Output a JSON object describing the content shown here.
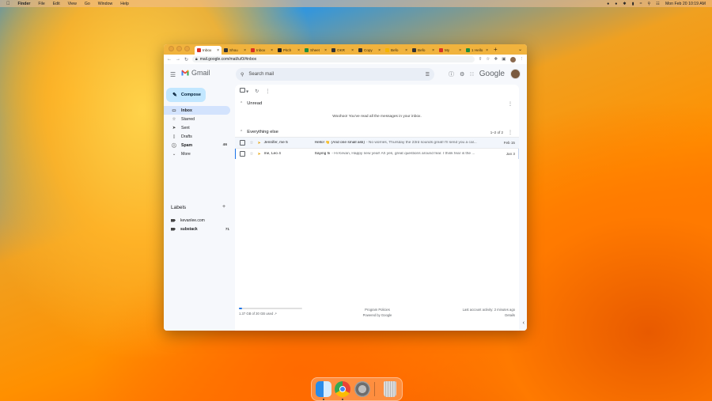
{
  "menubar": {
    "apple": "",
    "app": "Finder",
    "menus": [
      "File",
      "Edit",
      "View",
      "Go",
      "Window",
      "Help"
    ],
    "clock": "Mon Feb 20  10:19 AM"
  },
  "browser": {
    "tabs": [
      {
        "title": "Inbox",
        "active": true,
        "favicon_color": "#d93025"
      },
      {
        "title": "Shou",
        "favicon_color": "#333333"
      },
      {
        "title": "Inbox",
        "favicon_color": "#d93025"
      },
      {
        "title": "Pitch",
        "favicon_color": "#222222"
      },
      {
        "title": "Sheet",
        "favicon_color": "#1e8e3e"
      },
      {
        "title": "OKR",
        "favicon_color": "#333333"
      },
      {
        "title": "Copy",
        "favicon_color": "#333333"
      },
      {
        "title": "Befo",
        "favicon_color": "#f4b400"
      },
      {
        "title": "Befo",
        "favicon_color": "#333333"
      },
      {
        "title": "My",
        "favicon_color": "#d93025"
      },
      {
        "title": "1 Hello",
        "favicon_color": "#1e8e3e"
      }
    ],
    "url": "mail.google.com/mail/u/0/#inbox"
  },
  "gmail": {
    "logo": "Gmail",
    "search_placeholder": "Search mail",
    "google": "Google",
    "compose": "Compose",
    "nav": [
      {
        "label": "Inbox",
        "icon": "inbox-icon",
        "active": true,
        "count": ""
      },
      {
        "label": "Starred",
        "icon": "star-icon",
        "count": ""
      },
      {
        "label": "Sent",
        "icon": "send-icon",
        "count": ""
      },
      {
        "label": "Drafts",
        "icon": "draft-icon",
        "count": ""
      },
      {
        "label": "Spam",
        "icon": "spam-icon",
        "count": "46",
        "bold": true
      },
      {
        "label": "More",
        "icon": "chevron-down-icon",
        "count": ""
      }
    ],
    "labels_heading": "Labels",
    "labels": [
      {
        "name": "kevanlee.com",
        "count": ""
      },
      {
        "name": "substack",
        "count": "71"
      }
    ],
    "sections": {
      "unread": "Unread",
      "unread_empty": "Woohoo! You've read all the messages in your inbox.",
      "everything": "Everything else",
      "range": "1–2 of 2"
    },
    "emails": [
      {
        "from": "Jennifer, me 5",
        "subject": "Hello! 👋 (And one small ask)",
        "snippet": " - No worries, Thursday the 23rd sounds great! I'll send you a cal...",
        "date": "Feb 15"
      },
      {
        "from": "me, Leo 4",
        "subject": "Saying hi",
        "snippet": " - Hi Kevan, Happy new year! Ah yes, great questions around fear. I think fear is the ...",
        "date": "Jan 3"
      }
    ],
    "footer": {
      "storage": "1.37 GB of 30 GB used",
      "storage_fraction": 0.046,
      "policies": "Program Policies",
      "powered": "Powered by Google",
      "activity": "Last account activity: 2 minutes ago",
      "details": "Details"
    }
  }
}
